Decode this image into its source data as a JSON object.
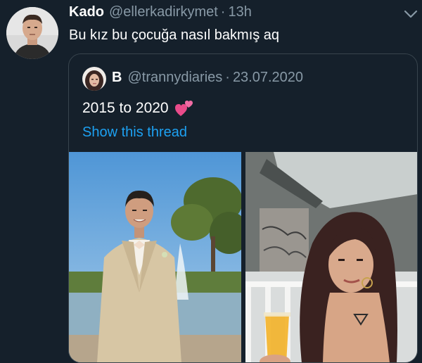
{
  "tweet": {
    "author_name": "Kado",
    "author_handle": "@ellerkadirkymet",
    "separator": "·",
    "time": "13h",
    "text": "Bu kız bu çocuğa nasıl bakmış aq"
  },
  "quoted_tweet": {
    "author_name": "B",
    "author_handle": "@trannydiaries",
    "separator": "·",
    "date": "23.07.2020",
    "text": "2015 to 2020",
    "emoji": "two-hearts-icon",
    "show_thread_label": "Show this thread"
  },
  "colors": {
    "background": "#15202b",
    "border": "#38444d",
    "secondary_text": "#8899a6",
    "link": "#1da1f2"
  },
  "icons": {
    "menu": "chevron-down-icon"
  }
}
